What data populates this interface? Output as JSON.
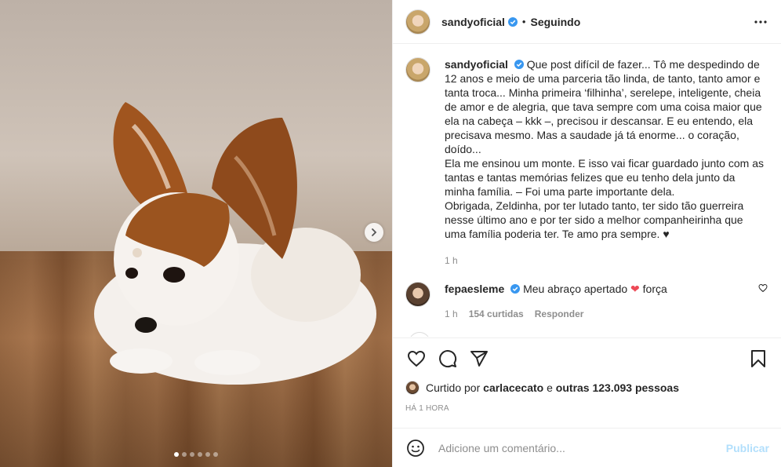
{
  "post": {
    "author": "sandyoficial",
    "follow_status": "Seguindo",
    "separator": "•",
    "media": {
      "slide_count": 6,
      "active_slide": 1,
      "description_icon": "dog-photo"
    },
    "caption": {
      "username": "sandyoficial",
      "lines": [
        "Que post difícil de fazer... Tô me despedindo de 12 anos e meio de uma parceria tão linda, de tanto, tanto amor e tanta troca... Minha primeira ‘filhinha’, serelepe, inteligente, cheia de amor e de alegria, que tava sempre com uma coisa maior que ela na cabeça – kkk –, precisou ir descansar. E eu entendo, ela precisava mesmo. Mas a saudade já tá enorme... o coração, doído...",
        "Ela me ensinou um monte. E isso vai ficar guardado junto com as tantas e tantas memórias felizes que eu tenho dela junto da minha família. – Foi uma parte importante dela.",
        "Obrigada, Zeldinha, por ter lutado tanto, ter sido tão guerreira nesse último ano e por ter sido a melhor companheirinha que uma família poderia ter. Te amo pra sempre. ♥"
      ],
      "time": "1 h"
    },
    "comments": [
      {
        "username": "fepaesleme",
        "text_before": "Meu abraço apertado ",
        "emoji": "❤",
        "text_after": " força",
        "time": "1 h",
        "likes": "154 curtidas",
        "reply": "Responder"
      }
    ],
    "likes": {
      "prefix": "Curtido por ",
      "first_user": "carlacecato",
      "middle": " e ",
      "others": "outras 123.093 pessoas"
    },
    "timestamp": "HÁ 1 HORA",
    "add_comment": {
      "placeholder": "Adicione um comentário...",
      "publish": "Publicar"
    }
  },
  "icons": {
    "more": "more-options-icon",
    "like": "heart-icon",
    "comment": "comment-icon",
    "share": "share-icon",
    "save": "bookmark-icon",
    "emoji": "emoji-icon",
    "next": "chevron-right-icon",
    "verified": "verified-badge-icon"
  },
  "colors": {
    "verified": "#3897f0",
    "heart": "#ed4956",
    "publish_disabled": "#b2dffc",
    "muted": "#8e8e8e"
  }
}
